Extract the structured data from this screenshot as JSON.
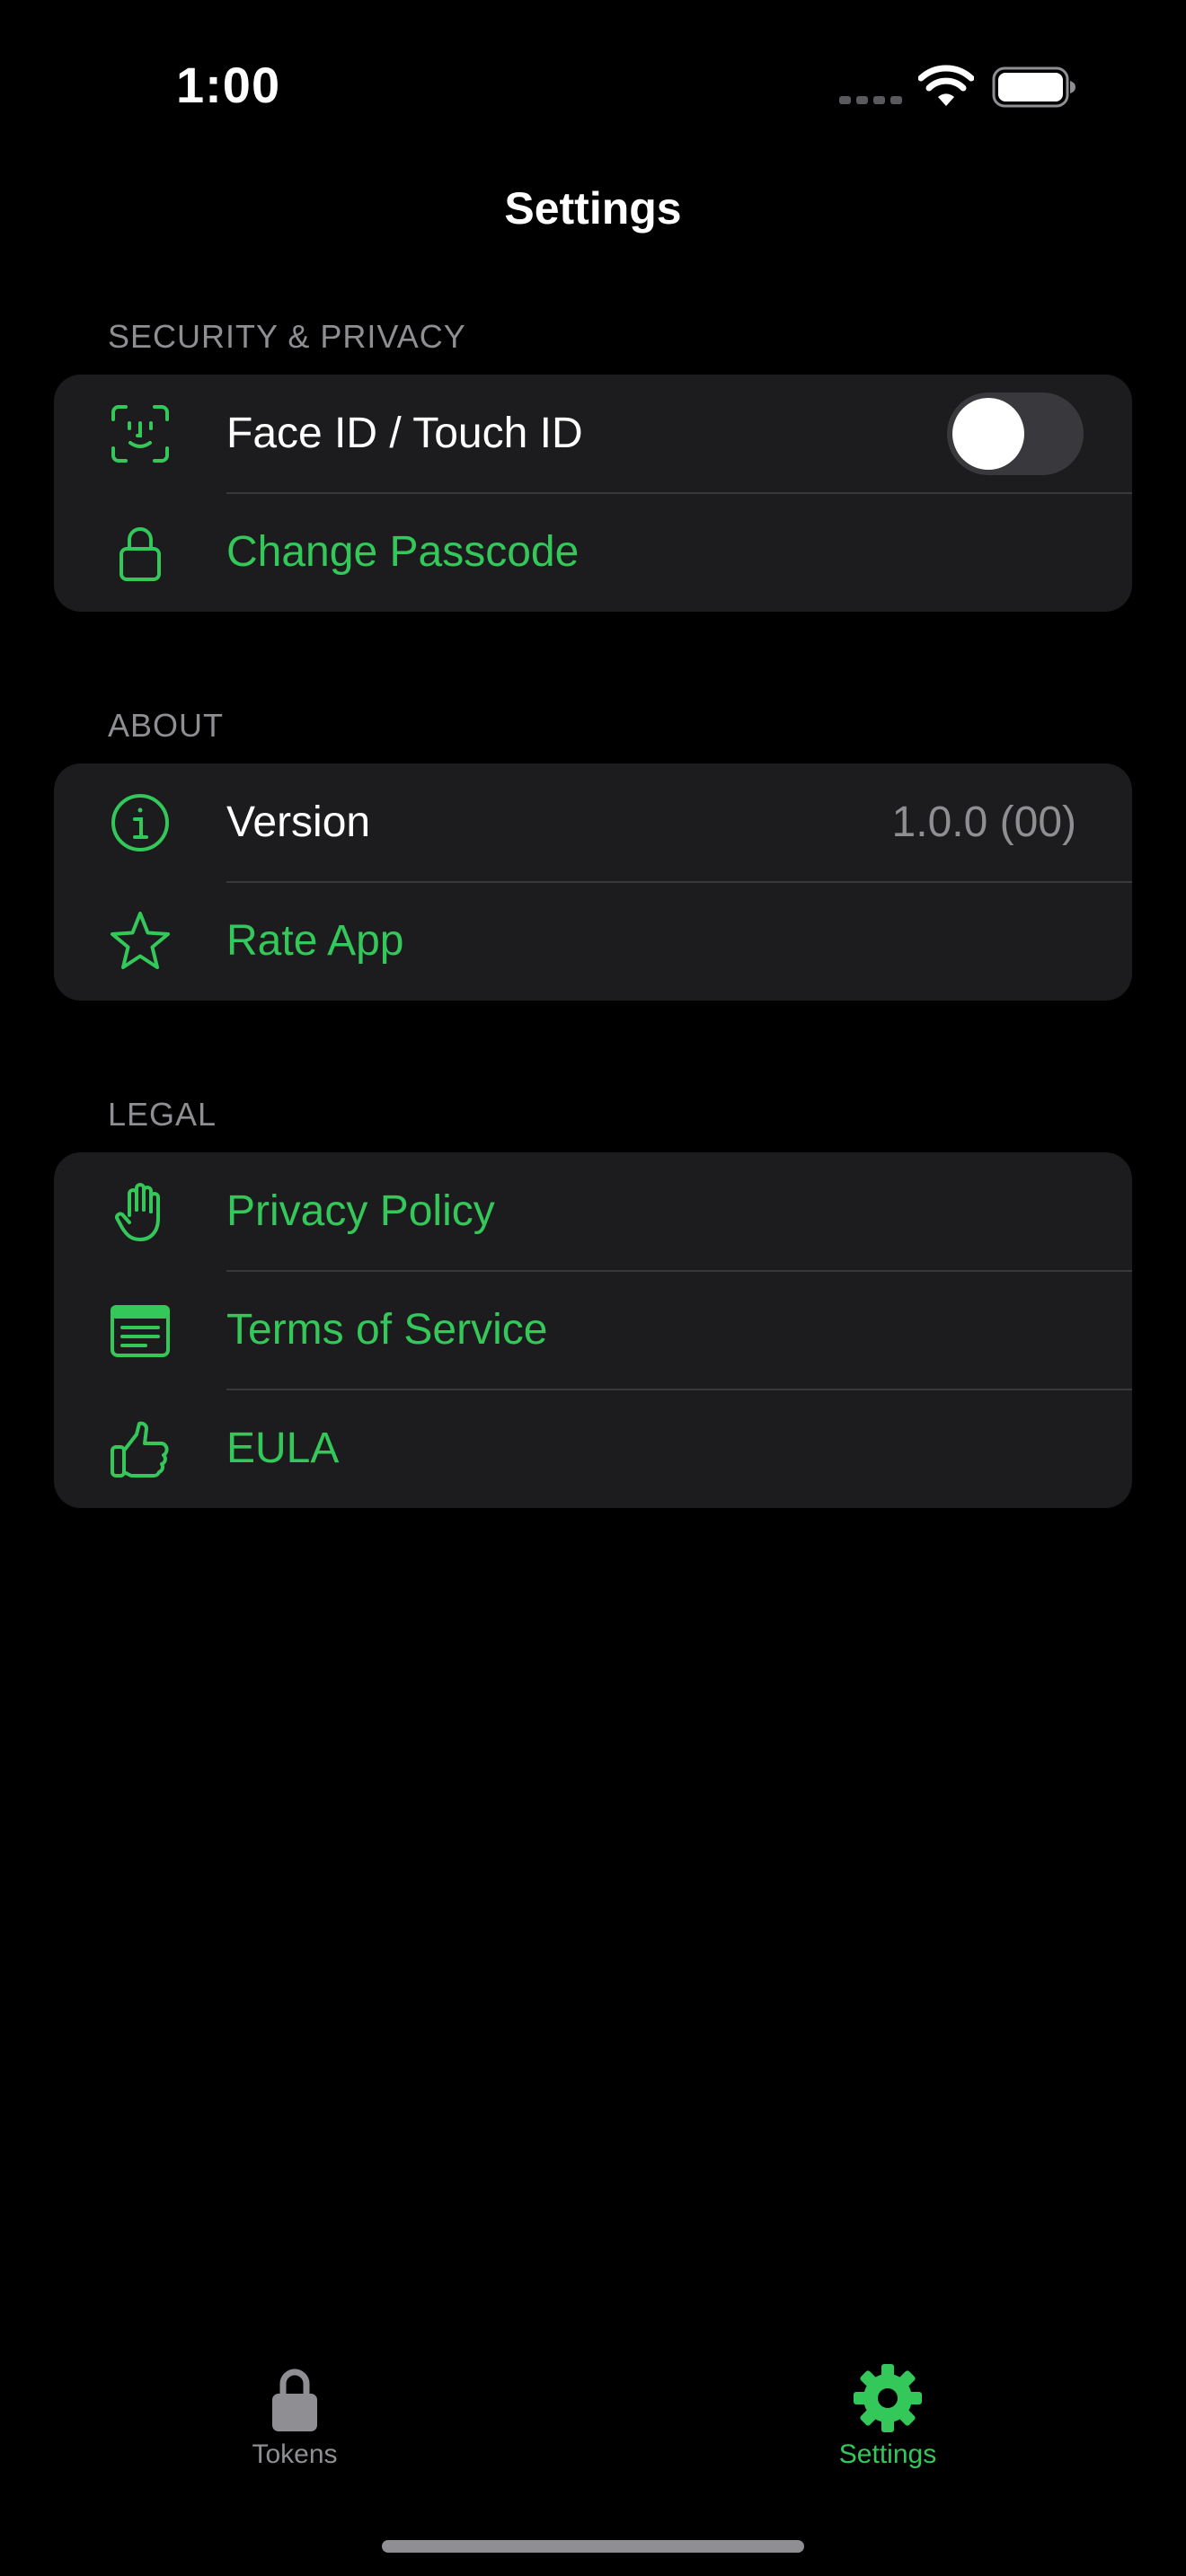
{
  "status_bar": {
    "time": "1:00"
  },
  "nav": {
    "title": "Settings"
  },
  "sections": {
    "security": {
      "header": "SECURITY & PRIVACY",
      "face_id": {
        "label": "Face ID / Touch ID",
        "icon": "faceid-icon",
        "enabled": false
      },
      "change_passcode": {
        "label": "Change Passcode",
        "icon": "lock-icon"
      }
    },
    "about": {
      "header": "ABOUT",
      "version": {
        "label": "Version",
        "value": "1.0.0 (00)",
        "icon": "info-circle-icon"
      },
      "rate_app": {
        "label": "Rate App",
        "icon": "star-icon"
      }
    },
    "legal": {
      "header": "LEGAL",
      "privacy": {
        "label": "Privacy Policy",
        "icon": "hand-raised-icon"
      },
      "terms": {
        "label": "Terms of Service",
        "icon": "document-text-icon"
      },
      "eula": {
        "label": "EULA",
        "icon": "thumbs-up-icon"
      }
    }
  },
  "tab_bar": {
    "tokens": {
      "label": "Tokens",
      "icon": "lock-fill-icon",
      "selected": false
    },
    "settings": {
      "label": "Settings",
      "icon": "gear-fill-icon",
      "selected": true
    }
  },
  "colors": {
    "accent": "#34c759",
    "background": "#000000",
    "group_background": "#1c1c1e",
    "secondary_text": "#8e8e93"
  }
}
